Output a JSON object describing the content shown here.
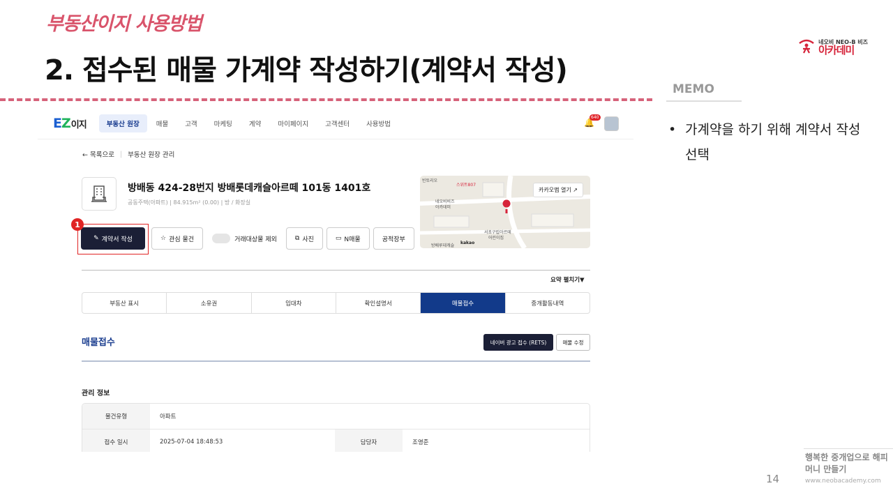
{
  "slide": {
    "subtitle": "부동산이지 사용방법",
    "title": "2. 접수된 매물 가계약 작성하기(계약서 작성)",
    "logo_small": "네오비 NEO-B 비즈",
    "logo_big": "아카데미",
    "memo_label": "MEMO",
    "memo_bullet": "•",
    "memo_text": "가계약을 하기 위해 계약서 작성 선택",
    "slogan": "행복한 중개업으로 해피머니 만들기",
    "site": "www.neobacademy.com",
    "page_number": "14"
  },
  "app": {
    "logo": {
      "e": "E",
      "z": "Z",
      "i": "이지"
    },
    "nav": [
      "부동산 원장",
      "매물",
      "고객",
      "마케팅",
      "계약",
      "마이페이지",
      "고객센터",
      "사용방법"
    ],
    "bell_badge": "640",
    "breadcrumb": {
      "back": "← 목록으로",
      "current": "부동산 원장 관리"
    },
    "property": {
      "title": "방배동 424-28번지 방배롯데캐슬아르떼 101동 1401호",
      "meta": "공동주택(아파트)   |   84.915m² (0.00)   |   방 / 화장실"
    },
    "actions": {
      "contract": "계약서 작성",
      "favorite": "관심 물건",
      "exclude": "거래대상물 제외",
      "photo": "사진",
      "nlisting": "N매물",
      "ledger": "공적장부"
    },
    "highlight_number": "1",
    "map": {
      "open_btn": "카카오맵 열기 ↗",
      "labels": [
        "빈토리오",
        "스위트807",
        "네오비비즈",
        "아카데미",
        "서초구립아르떼",
        "어린이집",
        "방배루데캐슬",
        "kakao"
      ]
    },
    "summary_toggle": "요약 펼치기▼",
    "tabs": [
      "부동산 표시",
      "소유권",
      "임대차",
      "확인설명서",
      "매물접수",
      "중개활동내역"
    ],
    "active_tab": "매물접수",
    "section_title": "매물접수",
    "rets_button": "네이버 광고 접수 (RETS)",
    "edit_button": "매물 수정",
    "info_title": "관리 정보",
    "info": {
      "type_label": "물건유형",
      "type_value": "아파트",
      "date_label": "접수 일시",
      "date_value": "2025-07-04 18:48:53",
      "manager_label": "담당자",
      "manager_value": "조영준"
    }
  }
}
